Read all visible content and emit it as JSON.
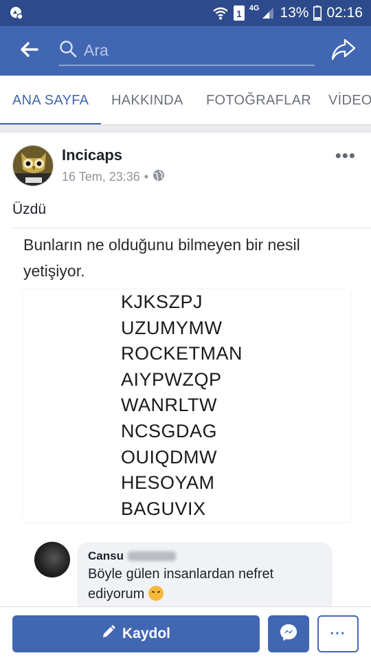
{
  "status_bar": {
    "network_label": "4G",
    "sim_label": "1",
    "battery_percent": "13%",
    "time": "02:16",
    "icons": [
      "notification-icon",
      "wifi-icon",
      "sim-icon",
      "signal-icon",
      "battery-icon"
    ]
  },
  "top_bar": {
    "back_icon": "arrow-left-icon",
    "search_placeholder": "Ara",
    "share_icon": "share-icon"
  },
  "tabs": [
    {
      "label": "ANA SAYFA",
      "active": true
    },
    {
      "label": "HAKKINDA",
      "active": false
    },
    {
      "label": "FOTOĞRAFLAR",
      "active": false
    },
    {
      "label": "VİDEOLAR",
      "active": false
    }
  ],
  "post": {
    "page_name": "Incicaps",
    "timestamp": "16 Tem, 23:36",
    "separator": "•",
    "privacy_icon": "globe-icon",
    "more_label": "•••",
    "text": "Üzdü",
    "image": {
      "caption": "Bunların ne olduğunu bilmeyen bir nesil yetişiyor.",
      "codes": [
        "KJKSZPJ",
        "UZUMYMW",
        "ROCKETMAN",
        "AIYPWZQP",
        "WANRLTW",
        "NCSGDAG",
        "OUIQDMW",
        "HESOYAM",
        "BAGUVIX"
      ],
      "comment": {
        "author": "Cansu",
        "text": "Böyle gülen insanlardan nefret ediyorum"
      }
    }
  },
  "bottom_bar": {
    "signup_label": "Kaydol",
    "messenger_icon": "messenger-icon",
    "more_label": "···"
  },
  "colors": {
    "status_bar": "#2d4b8c",
    "brand_blue": "#4267b2",
    "tab_inactive": "#6d7178"
  }
}
